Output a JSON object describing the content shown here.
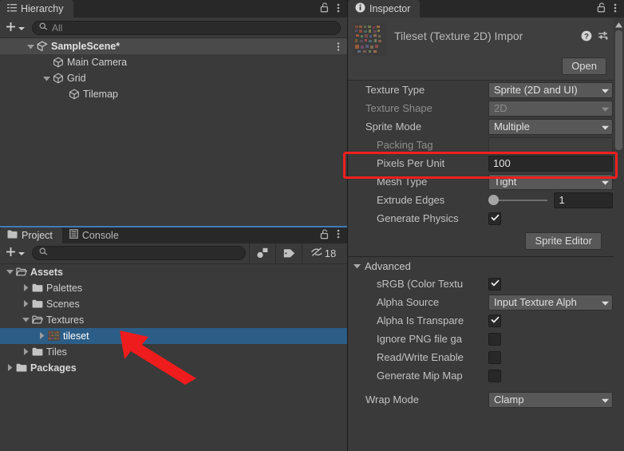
{
  "hierarchy": {
    "tab_label": "Hierarchy",
    "tab_icon": "hierarchy-icon",
    "lock_icon": "lock-open-icon",
    "menu_icon": "kebab-menu-icon",
    "create_label": "+",
    "search_placeholder": "All",
    "items": [
      {
        "label": "SampleScene*",
        "icon": "scene-icon",
        "depth": 1,
        "expanded": true,
        "header": true
      },
      {
        "label": "Main Camera",
        "icon": "gameobject-cube-icon",
        "depth": 2,
        "expanded": null,
        "header": false
      },
      {
        "label": "Grid",
        "icon": "gameobject-cube-icon",
        "depth": 2,
        "expanded": true,
        "header": false
      },
      {
        "label": "Tilemap",
        "icon": "gameobject-cube-icon",
        "depth": 3,
        "expanded": null,
        "header": false
      }
    ]
  },
  "project": {
    "tabs": [
      {
        "label": "Project",
        "icon": "folder-icon",
        "selected": true
      },
      {
        "label": "Console",
        "icon": "console-icon",
        "selected": false
      }
    ],
    "lock_icon": "lock-open-icon",
    "menu_icon": "kebab-menu-icon",
    "create_label": "+",
    "search_placeholder": "",
    "filter_type_icon": "filter-by-type-icon",
    "filter_label_icon": "filter-by-label-icon",
    "hidden_icon": "eye-hidden-icon",
    "hidden_count": "18",
    "items": [
      {
        "label": "Assets",
        "icon": "folder-open-icon",
        "depth": 0,
        "expanded": true,
        "bold": true,
        "selected": false
      },
      {
        "label": "Palettes",
        "icon": "folder-icon",
        "depth": 1,
        "expanded": false,
        "bold": false,
        "selected": false
      },
      {
        "label": "Scenes",
        "icon": "folder-icon",
        "depth": 1,
        "expanded": false,
        "bold": false,
        "selected": false
      },
      {
        "label": "Textures",
        "icon": "folder-open-icon",
        "depth": 1,
        "expanded": true,
        "bold": false,
        "selected": false
      },
      {
        "label": "tileset",
        "icon": "texture-asset-icon",
        "depth": 2,
        "expanded": false,
        "bold": false,
        "selected": true
      },
      {
        "label": "Tiles",
        "icon": "folder-icon",
        "depth": 1,
        "expanded": false,
        "bold": false,
        "selected": false
      },
      {
        "label": "Packages",
        "icon": "folder-icon",
        "depth": 0,
        "expanded": false,
        "bold": true,
        "selected": false
      }
    ]
  },
  "inspector": {
    "tab_label": "Inspector",
    "tab_icon": "info-icon",
    "lock_icon": "lock-open-icon",
    "menu_icon": "kebab-menu-icon",
    "asset_title": "Tileset (Texture 2D) Impor",
    "asset_thumb_icon": "tileset-texture-icon",
    "help_icon": "help-icon",
    "preset_icon": "preset-icon",
    "more_icon": "kebab-menu-icon",
    "open_label": "Open",
    "sprite_editor_label": "Sprite Editor",
    "properties": [
      {
        "name": "texture-type",
        "label": "Texture Type",
        "value": "Sprite (2D and UI)",
        "kind": "dropdown",
        "disabled": false,
        "indent": 1
      },
      {
        "name": "texture-shape",
        "label": "Texture Shape",
        "value": "2D",
        "kind": "dropdown",
        "disabled": true,
        "indent": 1
      },
      {
        "name": "sprite-mode",
        "label": "Sprite Mode",
        "value": "Multiple",
        "kind": "dropdown",
        "disabled": false,
        "indent": 1
      },
      {
        "name": "packing-tag",
        "label": "Packing Tag",
        "value": "",
        "kind": "text-empty",
        "disabled": true,
        "indent": 2
      },
      {
        "name": "pixels-per-unit",
        "label": "Pixels Per Unit",
        "value": "100",
        "kind": "text",
        "disabled": false,
        "indent": 2
      },
      {
        "name": "mesh-type",
        "label": "Mesh Type",
        "value": "Tight",
        "kind": "dropdown",
        "disabled": false,
        "indent": 2
      },
      {
        "name": "extrude-edges",
        "label": "Extrude Edges",
        "value": "1",
        "kind": "slider",
        "disabled": false,
        "indent": 2
      },
      {
        "name": "generate-physics",
        "label": "Generate Physics",
        "value": true,
        "kind": "checkbox",
        "disabled": false,
        "indent": 2
      }
    ],
    "advanced": {
      "label": "Advanced",
      "expanded": true,
      "properties": [
        {
          "name": "srgb-color-texture",
          "label": "sRGB (Color Textu",
          "value": true,
          "kind": "checkbox",
          "indent": 2
        },
        {
          "name": "alpha-source",
          "label": "Alpha Source",
          "value": "Input Texture Alph",
          "kind": "dropdown",
          "indent": 2
        },
        {
          "name": "alpha-is-transparency",
          "label": "Alpha Is Transpare",
          "value": true,
          "kind": "checkbox",
          "indent": 2
        },
        {
          "name": "ignore-png-gamma",
          "label": "Ignore PNG file ga",
          "value": false,
          "kind": "checkbox",
          "indent": 2
        },
        {
          "name": "read-write-enabled",
          "label": "Read/Write Enable",
          "value": false,
          "kind": "checkbox",
          "indent": 2
        },
        {
          "name": "generate-mip-maps",
          "label": "Generate Mip Map",
          "value": false,
          "kind": "checkbox",
          "indent": 2
        }
      ]
    },
    "wrap_mode": {
      "name": "wrap-mode",
      "label": "Wrap Mode",
      "value": "Clamp",
      "kind": "dropdown",
      "indent": 1
    }
  },
  "annotations": {
    "highlight_color": "#f01f1f",
    "highlight_target": "pixels-per-unit",
    "arrow_color": "#ee1c1c",
    "arrow_target": "tileset"
  },
  "colors": {
    "panel_bg": "#3a3a3a",
    "tabbar_bg": "#282828",
    "selection_blue": "#2c5d87",
    "active_tab_border": "#3d7cb8",
    "field_bg": "#282828",
    "control_bg": "#585858"
  }
}
